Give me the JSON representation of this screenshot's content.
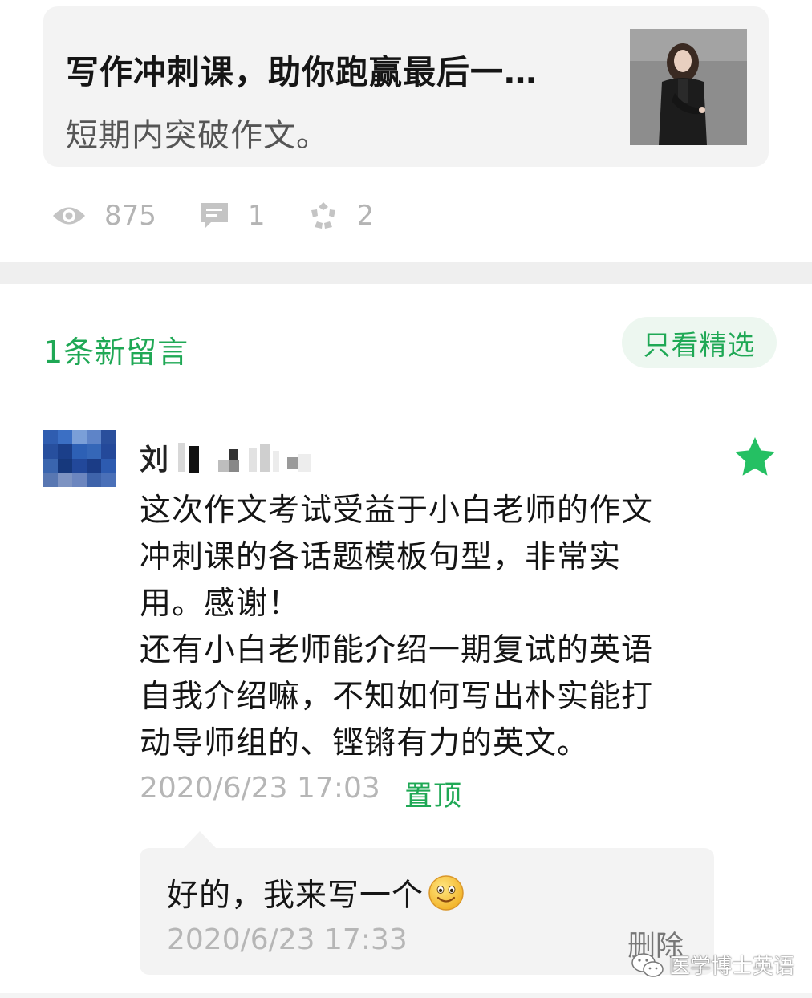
{
  "article": {
    "title": "写作冲刺课，助你跑赢最后一…",
    "subtitle": "短期内突破作文。"
  },
  "stats": {
    "views": "875",
    "comments": "1",
    "likes": "2",
    "views_icon": "eye-icon",
    "comments_icon": "comment-icon",
    "likes_icon": "wow-icon"
  },
  "comments_header": {
    "new_comments": "1条新留言",
    "featured_only": "只看精选"
  },
  "comment": {
    "username": "刘",
    "starred": true,
    "lines": [
      "这次作文考试受益于小白老师的作文",
      "冲刺课的各话题模板句型，非常实",
      "用。感谢！",
      "还有小白老师能介绍一期复试的英语",
      "自我介绍嘛，不知如何写出朴实能打",
      "动导师组的、铿锵有力的英文。"
    ],
    "time": "2020/6/23 17:03",
    "pin_label": "置顶"
  },
  "reply": {
    "text": "好的，我来写一个",
    "emoji": "smiley-icon",
    "time": "2020/6/23 17:33",
    "delete_label": "删除"
  },
  "watermark": {
    "label": "医学博士英语",
    "icon": "wechat-icon"
  },
  "colors": {
    "accent_green": "#1fa855",
    "card_bg": "#f3f3f3",
    "muted_text": "#b6b6b6"
  }
}
